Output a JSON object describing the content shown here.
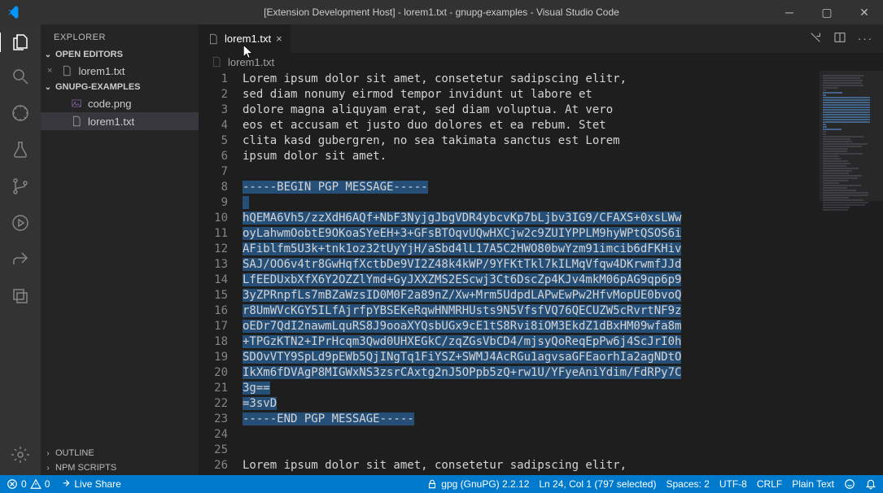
{
  "window": {
    "title": "[Extension Development Host] - lorem1.txt - gnupg-examples - Visual Studio Code"
  },
  "sidebar": {
    "title": "EXPLORER",
    "open_editors": {
      "label": "OPEN EDITORS",
      "items": [
        {
          "icon": "close",
          "file_icon": "txt",
          "name": "lorem1.txt"
        }
      ]
    },
    "workspace": {
      "label": "GNUPG-EXAMPLES",
      "items": [
        {
          "file_icon": "img",
          "name": "code.png"
        },
        {
          "file_icon": "txt",
          "name": "lorem1.txt"
        }
      ]
    },
    "outline_label": "OUTLINE",
    "npm_label": "NPM SCRIPTS"
  },
  "tabs": {
    "items": [
      {
        "file_icon": "txt",
        "name": "lorem1.txt"
      }
    ]
  },
  "breadcrumb": {
    "file_icon": "txt",
    "name": "lorem1.txt"
  },
  "editor": {
    "lines": [
      "Lorem ipsum dolor sit amet, consetetur sadipscing elitr,",
      "sed diam nonumy eirmod tempor invidunt ut labore et",
      "dolore magna aliquyam erat, sed diam voluptua. At vero",
      "eos et accusam et justo duo dolores et ea rebum. Stet",
      "clita kasd gubergren, no sea takimata sanctus est Lorem",
      "ipsum dolor sit amet.",
      "",
      "-----BEGIN PGP MESSAGE-----",
      "",
      "hQEMA6Vh5/zzXdH6AQf+NbF3NyjgJbgVDR4ybcvKp7bLjbv3IG9/CFAXS+0xsLWw",
      "oyLahwmOobtE9OKoaSYeEH+3+GFsBTOqvUQwHXCjw2c9ZUIYPPLM9hyWPtQSOS6i",
      "AFiblfm5U3k+tnk1oz32tUyYjH/aSbd4lL17A5C2HWO80bwYzm91imcib6dFKHiv",
      "SAJ/OO6v4tr8GwHqfXctbDe9VI2Z48k4kWP/9YFKtTkl7kILMqVfqw4DKrwmfJJd",
      "LfEEDUxbXfX6Y2OZZlYmd+GyJXXZMS2EScwj3Ct6DscZp4KJv4mkM06pAG9qp6p9",
      "3yZPRnpfLs7mBZaWzsID0M0F2a89nZ/Xw+Mrm5UdpdLAPwEwPw2HfvMopUE0bvoQ",
      "r8UmWVcKGY5ILfAjrfpYBSEKeRqwHNMRHUsts9N5VfsfVQ76QECUZW5cRvrtNF9z",
      "oEDr7QdI2nawmLquRS8J9ooaXYQsbUGx9cE1tS8Rvi8iOM3EkdZ1dBxHM09wfa8m",
      "+TPGzKTN2+IPrHcqm3Qwd0UHXEGkC/zqZGsVbCD4/mjsyQoReqEpPw6j4ScJrI0h",
      "SDOvVTY9SpLd9pEWb5QjINgTq1FiYSZ+SWMJ4AcRGu1agvsaGFEaorhIa2agNDtO",
      "IkXm6fDVAgP8MIGWxNS3zsrCAxtg2nJ5OPpb5zQ+rw1U/YFyeAniYdim/FdRPy7C",
      "3g==",
      "=3svD",
      "-----END PGP MESSAGE-----",
      "",
      "",
      "Lorem ipsum dolor sit amet, consetetur sadipscing elitr,"
    ],
    "first_line_number": 1,
    "selection_start": 8,
    "selection_end": 23,
    "partial_line_9": true
  },
  "status": {
    "errors": "0",
    "warnings": "0",
    "liveshare": "Live Share",
    "gpg": "gpg (GnuPG) 2.2.12",
    "position": "Ln 24, Col 1 (797 selected)",
    "spaces": "Spaces: 2",
    "encoding": "UTF-8",
    "eol": "CRLF",
    "language": "Plain Text"
  }
}
